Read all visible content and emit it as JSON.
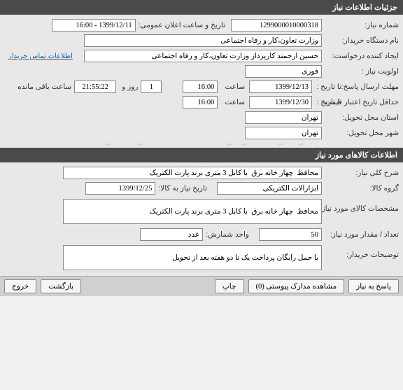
{
  "need_info": {
    "title": "جزئیات اطلاعات نیاز",
    "need_number_label": "شماره نیاز:",
    "need_number": "1299000010000318",
    "announce_label": "تاریخ و ساعت اعلان عمومی:",
    "announce_value": "1399/12/11 - 16:00",
    "buyer_org_label": "نام دستگاه خریدار:",
    "buyer_org": "وزارت تعاون،کار و رفاه اجتماعی",
    "requester_label": "ایجاد کننده درخواست:",
    "requester": "حسین ارجمند کارپرداز وزارت تعاون،کار و رفاه اجتماعی",
    "contact_link": "اطلاعات تماس خریدار",
    "priority_label": "اولویت نیاز :",
    "priority": "فوری",
    "deadline_label": "مهلت ارسال پاسخ:",
    "to_date_label": "تا تاریخ :",
    "deadline_date": "1399/12/13",
    "time_label": "ساعت",
    "deadline_time": "16:00",
    "days_field": "1",
    "days_label": "روز و",
    "countdown": "21:55:22",
    "remaining_label": "ساعت باقی مانده",
    "min_validity_label": "حداقل تاریخ اعتبار قیمت:",
    "min_validity_date": "1399/12/30",
    "min_validity_time": "16:00",
    "delivery_province_label": "استان محل تحویل:",
    "delivery_province": "تهران",
    "delivery_city_label": "شهر محل تحویل:",
    "delivery_city": "تهران"
  },
  "goods_info": {
    "title": "اطلاعات کالاهای مورد نیاز",
    "need_desc_label": "شرح کلی نیاز:",
    "need_desc": "محافظ  چهار خانه برق  با کابل 3 متری برند پارت الکتریک",
    "goods_group_label": "گروه کالا:",
    "goods_group": "ابزارآلات الکتریکی",
    "need_date_label": "تاریخ نیاز به کالا:",
    "need_date": "1399/12/25",
    "goods_spec_label": "مشخصات کالای مورد نیاز:",
    "goods_spec": "محافظ  چهار خانه برق  با کابل 3 متری برند پارت الکتریک",
    "qty_label": "تعداد / مقدار مورد نیاز:",
    "qty": "50",
    "unit_label": "واحد شمارش:",
    "unit": "عدد",
    "buyer_notes_label": "توضیحات خریدار:",
    "buyer_notes": "با حمل رایگان پرداخت یک تا دو هفته بعد از تحویل"
  },
  "buttons": {
    "respond": "پاسخ به نیاز",
    "attachments": "مشاهده مدارک پیوستی (0)",
    "print": "چاپ",
    "back": "بازگشت",
    "exit": "خروج"
  },
  "watermark": {
    "line1": "مرکز آمار و اطلاعات راهبردی",
    "line2": "۰۲۱-۸۸۳۴۹۶۷۰-۵"
  }
}
